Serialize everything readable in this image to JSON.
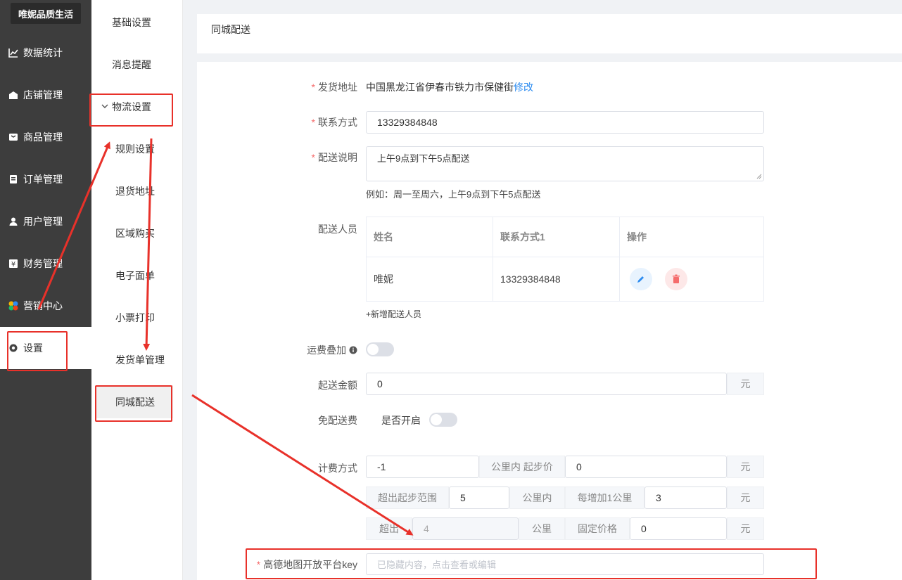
{
  "sidebar": {
    "logo": "唯妮品质生活",
    "items": [
      {
        "label": "数据统计",
        "icon": "chart-line-icon"
      },
      {
        "label": "店铺管理",
        "icon": "store-icon"
      },
      {
        "label": "商品管理",
        "icon": "product-icon"
      },
      {
        "label": "订单管理",
        "icon": "order-icon"
      },
      {
        "label": "用户管理",
        "icon": "user-icon"
      },
      {
        "label": "财务管理",
        "icon": "finance-icon"
      },
      {
        "label": "营销中心",
        "icon": "marketing-icon"
      },
      {
        "label": "设置",
        "icon": "gear-icon"
      }
    ]
  },
  "submenu": {
    "items": [
      "基础设置",
      "消息提醒",
      "物流设置"
    ],
    "children": [
      "规则设置",
      "退货地址",
      "区域购买",
      "电子面单",
      "小票打印",
      "发货单管理",
      "同城配送"
    ]
  },
  "page": {
    "title": "同城配送"
  },
  "form": {
    "address_label": "发货地址",
    "address_value": "中国黑龙江省伊春市铁力市保健街",
    "address_edit": "修改",
    "contact_label": "联系方式",
    "contact_value": "13329384848",
    "desc_label": "配送说明",
    "desc_value": "上午9点到下午5点配送",
    "desc_hint": "例如：周一至周六，上午9点到下午5点配送",
    "staff_label": "配送人员",
    "staff_table": {
      "headers": [
        "姓名",
        "联系方式1",
        "操作"
      ],
      "rows": [
        {
          "name": "唯妮",
          "phone": "13329384848"
        }
      ]
    },
    "add_staff": "+新增配送人员",
    "fee_stack_label": "运费叠加",
    "min_amount_label": "起送金额",
    "min_amount_value": "0",
    "yuan": "元",
    "free_label": "免配送费",
    "free_switch_label": "是否开启",
    "billing_label": "计费方式",
    "billing_km": "-1",
    "billing_km_suffix": "公里内 起步价",
    "billing_start_price": "0",
    "exceed_range_label": "超出起步范围",
    "exceed_range_value": "5",
    "km_inside": "公里内",
    "per_km_label": "每增加1公里",
    "per_km_value": "3",
    "exceed_label": "超出",
    "exceed_value": "4",
    "km": "公里",
    "fixed_price_label": "固定价格",
    "fixed_price_value": "0",
    "amap_key_label": "高德地图开放平台key",
    "amap_key_placeholder": "已隐藏内容，点击查看或编辑"
  },
  "colors": {
    "sidebar_bg": "#3d3d3d",
    "link": "#2d8cf0",
    "required": "#f56c6c",
    "annotation_red": "#e8312a"
  }
}
